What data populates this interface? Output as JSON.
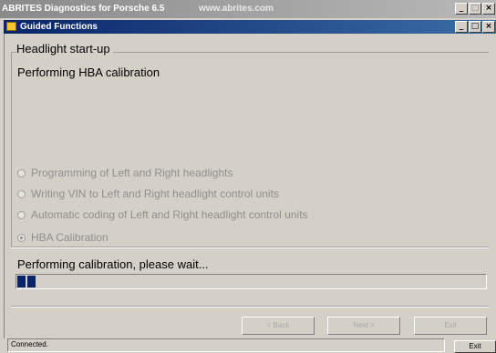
{
  "outer_window": {
    "title": "ABRITES Diagnostics for Porsche 6.5",
    "url": "www.abrites.com",
    "minimize": "_",
    "maximize": "□",
    "close": "×"
  },
  "inner_window": {
    "title": "Guided Functions",
    "minimize": "_",
    "maximize": "□",
    "close": "×"
  },
  "group": {
    "title": "Headlight start-up",
    "subtitle": "Performing HBA calibration"
  },
  "steps": [
    {
      "label": "Programming of Left and Right headlights",
      "checked": false
    },
    {
      "label": "Writing VIN to Left and Right headlight  control units",
      "checked": false
    },
    {
      "label": "Automatic coding of Left and Right headlight  control units",
      "checked": false
    },
    {
      "label": "HBA Calibration",
      "checked": true
    }
  ],
  "status_message": "Performing calibration, please wait...",
  "progress": {
    "fraction": 0.04,
    "blocks": 2
  },
  "buttons": {
    "back": "< Back",
    "next": "Next >",
    "exit": "Exit"
  },
  "statusbar": {
    "text": "Connected.",
    "exit": "Exit"
  },
  "colors": {
    "title_active": "#0a246a",
    "progress": "#0a246a",
    "disabled_text": "#8f8f8f"
  }
}
